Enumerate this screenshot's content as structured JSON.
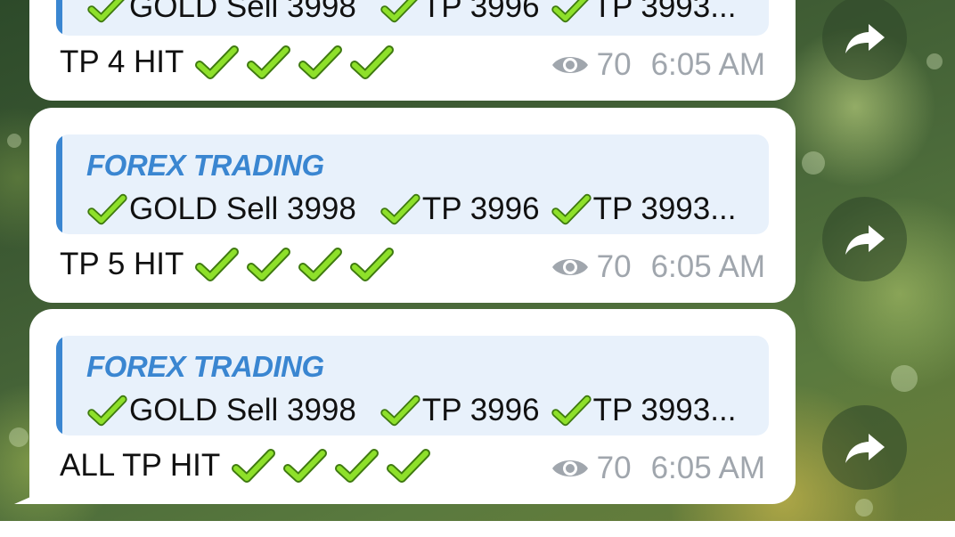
{
  "channel_name": "FOREX TRADING",
  "quoted_text": [
    "GOLD Sell 3998",
    "TP 3996",
    "TP 3993..."
  ],
  "messages": [
    {
      "text": "TP 4 HIT",
      "checks": 4,
      "views": "70",
      "time": "6:05 AM",
      "has_quote": true,
      "quote_partial": true
    },
    {
      "text": "TP 5 HIT",
      "checks": 4,
      "views": "70",
      "time": "6:05 AM",
      "has_quote": true
    },
    {
      "text": "ALL TP HIT",
      "checks": 4,
      "views": "70",
      "time": "6:05 AM",
      "has_quote": true
    }
  ],
  "icons": {
    "check": "heavy-check-mark-icon",
    "views": "eye-icon",
    "forward": "share-forward-icon"
  },
  "colors": {
    "quote_accent": "#3a86d1",
    "quote_background": "#e8f1fb",
    "meta_text": "#a0a6ad",
    "check_green": "#7fd21b"
  }
}
